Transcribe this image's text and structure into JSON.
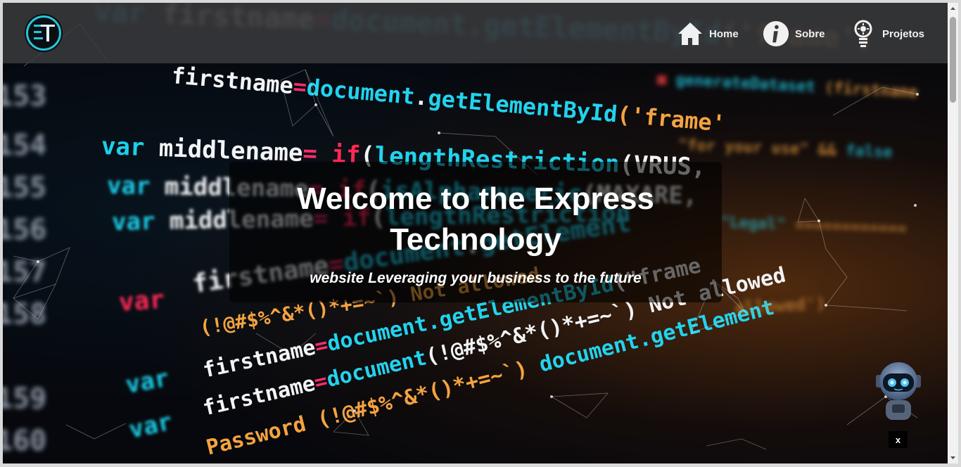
{
  "nav": {
    "items": [
      {
        "label": "Home",
        "icon": "home-icon"
      },
      {
        "label": "Sobre",
        "icon": "info-icon"
      },
      {
        "label": "Projetos",
        "icon": "lightbulb-icon"
      }
    ]
  },
  "logo": {
    "icon": "et-logo-icon",
    "accent": "#26c6da"
  },
  "hero": {
    "title": "Welcome to the Express Technology",
    "subtitle": "website Leveraging your business to the future"
  },
  "chatbot": {
    "icon": "robot-icon",
    "close_label": "x"
  }
}
